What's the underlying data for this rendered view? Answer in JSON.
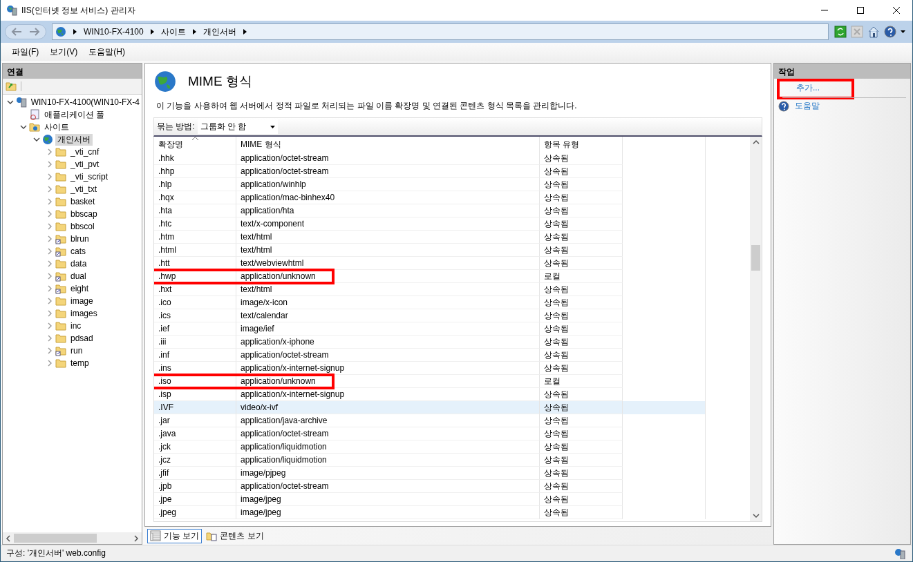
{
  "window": {
    "title": "IIS(인터넷 정보 서비스) 관리자"
  },
  "address": {
    "crumbs": [
      "WIN10-FX-4100",
      "사이트",
      "개인서버"
    ]
  },
  "menu": [
    "파일(F)",
    "보기(V)",
    "도움말(H)"
  ],
  "connections": {
    "title": "연결",
    "tree": [
      {
        "label": "WIN10-FX-4100(WIN10-FX-4",
        "kind": "server",
        "expanded": true,
        "selected": false,
        "children": [
          {
            "label": "애플리케이션 풀",
            "kind": "pool",
            "selected": false
          },
          {
            "label": "사이트",
            "kind": "sites",
            "expanded": true,
            "selected": false,
            "children": [
              {
                "label": "개인서버",
                "kind": "site",
                "expanded": true,
                "selected": true,
                "children": [
                  {
                    "label": "_vti_cnf",
                    "kind": "folder",
                    "expanded": false,
                    "selected": false
                  },
                  {
                    "label": "_vti_pvt",
                    "kind": "folder",
                    "expanded": false,
                    "selected": false
                  },
                  {
                    "label": "_vti_script",
                    "kind": "folder",
                    "expanded": false,
                    "selected": false
                  },
                  {
                    "label": "_vti_txt",
                    "kind": "folder",
                    "expanded": false,
                    "selected": false
                  },
                  {
                    "label": "basket",
                    "kind": "folder",
                    "expanded": false,
                    "selected": false
                  },
                  {
                    "label": "bbscap",
                    "kind": "folder",
                    "expanded": false,
                    "selected": false
                  },
                  {
                    "label": "bbscol",
                    "kind": "folder",
                    "expanded": false,
                    "selected": false
                  },
                  {
                    "label": "blrun",
                    "kind": "virtual",
                    "expanded": false,
                    "selected": false
                  },
                  {
                    "label": "cats",
                    "kind": "virtual",
                    "expanded": false,
                    "selected": false
                  },
                  {
                    "label": "data",
                    "kind": "folder",
                    "expanded": false,
                    "selected": false
                  },
                  {
                    "label": "dual",
                    "kind": "virtual",
                    "expanded": false,
                    "selected": false
                  },
                  {
                    "label": "eight",
                    "kind": "virtual",
                    "expanded": false,
                    "selected": false
                  },
                  {
                    "label": "image",
                    "kind": "folder",
                    "expanded": false,
                    "selected": false
                  },
                  {
                    "label": "images",
                    "kind": "folder",
                    "expanded": false,
                    "selected": false
                  },
                  {
                    "label": "inc",
                    "kind": "folder",
                    "expanded": false,
                    "selected": false
                  },
                  {
                    "label": "pdsad",
                    "kind": "folder",
                    "expanded": false,
                    "selected": false
                  },
                  {
                    "label": "run",
                    "kind": "virtual",
                    "expanded": false,
                    "selected": false
                  },
                  {
                    "label": "temp",
                    "kind": "folder",
                    "expanded": false,
                    "selected": false
                  }
                ]
              }
            ]
          }
        ]
      }
    ]
  },
  "feature": {
    "title": "MIME 형식",
    "description": "이 기능을 사용하여 웹 서버에서 정적 파일로 처리되는 파일 이름 확장명 및 연결된 콘텐츠 형식 목록을 관리합니다.",
    "group_label": "묶는 방법:",
    "group_value": "그룹화 안 함"
  },
  "table": {
    "columns": [
      "확장명",
      "MIME 형식",
      "항목 유형"
    ],
    "rows": [
      {
        "cells": [
          ".hhk",
          "application/octet-stream",
          "상속됨"
        ],
        "selected": false,
        "highlighted": false
      },
      {
        "cells": [
          ".hhp",
          "application/octet-stream",
          "상속됨"
        ],
        "selected": false,
        "highlighted": false
      },
      {
        "cells": [
          ".hlp",
          "application/winhlp",
          "상속됨"
        ],
        "selected": false,
        "highlighted": false
      },
      {
        "cells": [
          ".hqx",
          "application/mac-binhex40",
          "상속됨"
        ],
        "selected": false,
        "highlighted": false
      },
      {
        "cells": [
          ".hta",
          "application/hta",
          "상속됨"
        ],
        "selected": false,
        "highlighted": false
      },
      {
        "cells": [
          ".htc",
          "text/x-component",
          "상속됨"
        ],
        "selected": false,
        "highlighted": false
      },
      {
        "cells": [
          ".htm",
          "text/html",
          "상속됨"
        ],
        "selected": false,
        "highlighted": false
      },
      {
        "cells": [
          ".html",
          "text/html",
          "상속됨"
        ],
        "selected": false,
        "highlighted": false
      },
      {
        "cells": [
          ".htt",
          "text/webviewhtml",
          "상속됨"
        ],
        "selected": false,
        "highlighted": false
      },
      {
        "cells": [
          ".hwp",
          "application/unknown",
          "로컬"
        ],
        "selected": false,
        "highlighted": true
      },
      {
        "cells": [
          ".hxt",
          "text/html",
          "상속됨"
        ],
        "selected": false,
        "highlighted": false
      },
      {
        "cells": [
          ".ico",
          "image/x-icon",
          "상속됨"
        ],
        "selected": false,
        "highlighted": false
      },
      {
        "cells": [
          ".ics",
          "text/calendar",
          "상속됨"
        ],
        "selected": false,
        "highlighted": false
      },
      {
        "cells": [
          ".ief",
          "image/ief",
          "상속됨"
        ],
        "selected": false,
        "highlighted": false
      },
      {
        "cells": [
          ".iii",
          "application/x-iphone",
          "상속됨"
        ],
        "selected": false,
        "highlighted": false
      },
      {
        "cells": [
          ".inf",
          "application/octet-stream",
          "상속됨"
        ],
        "selected": false,
        "highlighted": false
      },
      {
        "cells": [
          ".ins",
          "application/x-internet-signup",
          "상속됨"
        ],
        "selected": false,
        "highlighted": false
      },
      {
        "cells": [
          ".iso",
          "application/unknown",
          "로컬"
        ],
        "selected": false,
        "highlighted": true
      },
      {
        "cells": [
          ".isp",
          "application/x-internet-signup",
          "상속됨"
        ],
        "selected": false,
        "highlighted": false
      },
      {
        "cells": [
          ".IVF",
          "video/x-ivf",
          "상속됨"
        ],
        "selected": true,
        "highlighted": false
      },
      {
        "cells": [
          ".jar",
          "application/java-archive",
          "상속됨"
        ],
        "selected": false,
        "highlighted": false
      },
      {
        "cells": [
          ".java",
          "application/octet-stream",
          "상속됨"
        ],
        "selected": false,
        "highlighted": false
      },
      {
        "cells": [
          ".jck",
          "application/liquidmotion",
          "상속됨"
        ],
        "selected": false,
        "highlighted": false
      },
      {
        "cells": [
          ".jcz",
          "application/liquidmotion",
          "상속됨"
        ],
        "selected": false,
        "highlighted": false
      },
      {
        "cells": [
          ".jfif",
          "image/pjpeg",
          "상속됨"
        ],
        "selected": false,
        "highlighted": false
      },
      {
        "cells": [
          ".jpb",
          "application/octet-stream",
          "상속됨"
        ],
        "selected": false,
        "highlighted": false
      },
      {
        "cells": [
          ".jpe",
          "image/jpeg",
          "상속됨"
        ],
        "selected": false,
        "highlighted": false
      },
      {
        "cells": [
          ".jpeg",
          "image/jpeg",
          "상속됨"
        ],
        "selected": false,
        "highlighted": false
      }
    ]
  },
  "views": [
    {
      "label": "기능 보기",
      "selected": true
    },
    {
      "label": "콘텐츠 보기",
      "selected": false
    }
  ],
  "actions": {
    "title": "작업",
    "items": [
      {
        "label": "추가...",
        "kind": "link",
        "highlighted": true
      },
      {
        "label": "도움말",
        "kind": "help",
        "highlighted": false
      }
    ]
  },
  "status_bar": {
    "text": "구성: '개인서버' web.config"
  }
}
